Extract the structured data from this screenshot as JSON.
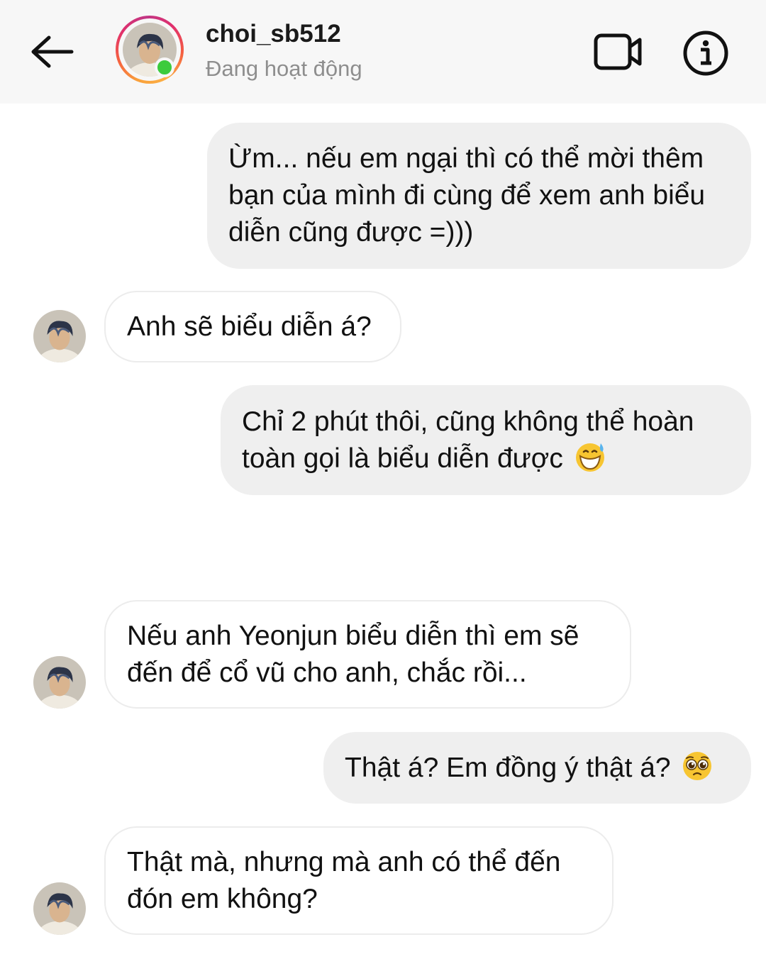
{
  "header": {
    "username": "choi_sb512",
    "status": "Đang hoạt động",
    "online_color": "#3ccb3c"
  },
  "icons": {
    "back": "arrow-left-icon",
    "video": "video-camera-icon",
    "info": "info-circle-icon"
  },
  "messages": [
    {
      "direction": "outgoing",
      "text": "Ừm... nếu em ngại thì có thể mời thêm bạn của mình đi cùng để xem anh biểu diễn cũng được =)))"
    },
    {
      "direction": "incoming",
      "text": "Anh sẽ biểu diễn á?"
    },
    {
      "direction": "outgoing",
      "text": "Chỉ 2 phút thôi, cũng không thể hoàn toàn gọi là biểu diễn được",
      "emoji": "grinning-sweat-emoji"
    },
    {
      "direction": "incoming",
      "text": "Nếu anh Yeonjun biểu diễn thì em sẽ đến để cổ vũ cho anh, chắc rồi..."
    },
    {
      "direction": "outgoing",
      "text": "Thật á? Em đồng ý thật á?",
      "emoji": "pleading-face-emoji"
    },
    {
      "direction": "incoming",
      "text": "Thật mà, nhưng mà anh có thể đến đón em không?"
    }
  ]
}
